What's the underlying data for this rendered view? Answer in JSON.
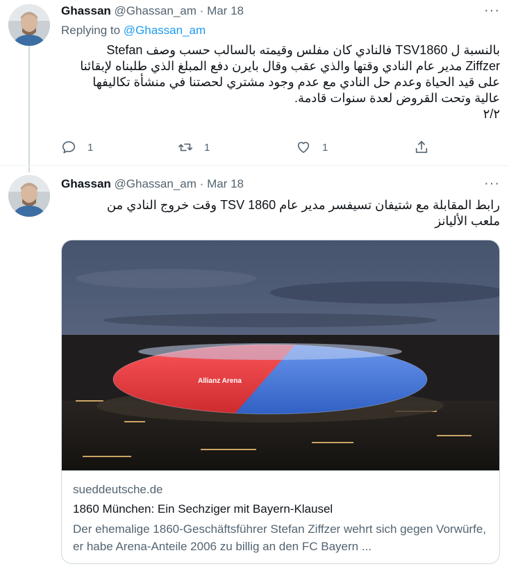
{
  "tweets": [
    {
      "author_name": "Ghassan",
      "author_handle": "@Ghassan_am",
      "date_sep": "·",
      "date": "Mar 18",
      "replying_prefix": "Replying to",
      "replying_handle": "@Ghassan_am",
      "text": "بالنسبة ل TSV1860 فالنادي كان مفلس وقيمته بالسالب حسب وصف Stefan\nZiffzer مدير عام النادي وقتها والذي عقب وقال بايرن دفع المبلغ الذي طلبناه لإبقائنا\nعلى قيد الحياة وعدم حل النادي مع عدم وجود مشتري لحصتنا في منشأة تكاليفها\nعالية وتحت القروض لعدة سنوات قادمة.\n٢/٢",
      "reply_count": "1",
      "retweet_count": "1",
      "like_count": "1"
    },
    {
      "author_name": "Ghassan",
      "author_handle": "@Ghassan_am",
      "date_sep": "·",
      "date": "Mar 18",
      "text": "رابط المقابلة مع شتيفان تسيفسر مدير عام TSV 1860 وقت خروج النادي من\nملعب الأليانز",
      "card": {
        "domain": "sueddeutsche.de",
        "title": "1860 München: Ein Sechziger mit Bayern-Klausel",
        "description": "Der ehemalige 1860-Geschäftsführer Stefan Ziffzer wehrt sich gegen Vorwürfe, er habe Arena-Anteile 2006 zu billig an den FC Bayern ...",
        "stadium_lettering": "Allianz Arena"
      }
    }
  ],
  "icons": {
    "more": "more-horizontal-icon",
    "reply": "speech-bubble-icon",
    "retweet": "retweet-arrows-icon",
    "like": "heart-icon",
    "share": "share-upload-icon"
  },
  "colors": {
    "text": "#0f1419",
    "secondary": "#536471",
    "link": "#1d9bf0",
    "border": "#cfd9de",
    "stadium_red": "#e8343a",
    "stadium_blue": "#3a6fd8"
  }
}
